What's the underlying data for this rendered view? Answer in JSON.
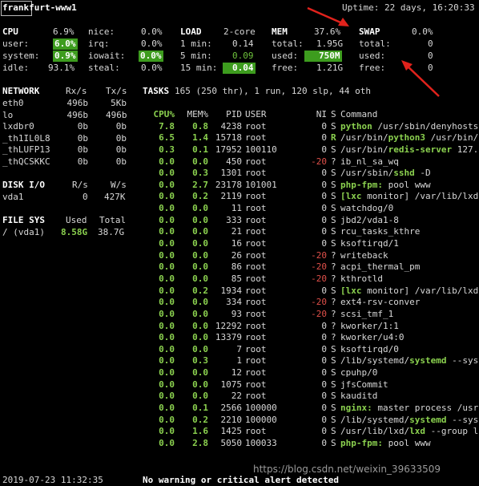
{
  "header": {
    "hostname": "frankfurt-www1",
    "uptime": "Uptime: 22 days, 16:20:33"
  },
  "cpu": {
    "label": "CPU",
    "total": "6.9%",
    "rows": [
      {
        "k1": "user:",
        "v1": "6.0%",
        "k2": "nice:",
        "v2": "0.0%"
      },
      {
        "k1": "system:",
        "v1": "0.9%",
        "k2": "irq:",
        "v2": "0.0%"
      },
      {
        "k1": "idle:",
        "v1": "93.1%",
        "k2": "iowait:",
        "v2": "0.0%"
      },
      {
        "k1": "",
        "v1": "",
        "k2": "steal:",
        "v2": "0.0%"
      }
    ]
  },
  "load": {
    "label": "LOAD",
    "cores": "2-core",
    "rows": [
      {
        "k": "1 min:",
        "v": "0.14"
      },
      {
        "k": "5 min:",
        "v": "0.09"
      },
      {
        "k": "15 min:",
        "v": "0.04"
      }
    ]
  },
  "mem": {
    "label": "MEM",
    "percent": "37.6%",
    "rows": [
      {
        "k": "total:",
        "v": "1.95G"
      },
      {
        "k": "used:",
        "v": "750M"
      },
      {
        "k": "free:",
        "v": "1.21G"
      }
    ]
  },
  "swap": {
    "label": "SWAP",
    "percent": "0.0%",
    "rows": [
      {
        "k": "total:",
        "v": "0"
      },
      {
        "k": "used:",
        "v": "0"
      },
      {
        "k": "free:",
        "v": "0"
      }
    ]
  },
  "network": {
    "label": "NETWORK",
    "rx": "Rx/s",
    "tx": "Tx/s",
    "rows": [
      {
        "name": "eth0",
        "rx": "496b",
        "tx": "5Kb"
      },
      {
        "name": "lo",
        "rx": "496b",
        "tx": "496b"
      },
      {
        "name": "lxdbr0",
        "rx": "0b",
        "tx": "0b"
      },
      {
        "name": "_th1IL0L8",
        "rx": "0b",
        "tx": "0b"
      },
      {
        "name": "_thLUFP13",
        "rx": "0b",
        "tx": "0b"
      },
      {
        "name": "_thQCSKKC",
        "rx": "0b",
        "tx": "0b"
      }
    ]
  },
  "disk": {
    "label": "DISK I/O",
    "r": "R/s",
    "w": "W/s",
    "rows": [
      {
        "name": "vda1",
        "r": "0",
        "w": "427K"
      }
    ]
  },
  "fs": {
    "label": "FILE SYS",
    "used": "Used",
    "total": "Total",
    "rows": [
      {
        "name": "/ (vda1)",
        "used": "8.58G",
        "total": "38.7G"
      }
    ]
  },
  "tasks": {
    "label": "TASKS",
    "summary": "165 (250 thr), 1 run, 120 slp, 44 oth"
  },
  "proc_headers": {
    "cpu": "CPU%",
    "mem": "MEM%",
    "pid": "PID",
    "user": "USER",
    "ni": "NI",
    "s": "S",
    "cmd": "Command"
  },
  "processes": [
    {
      "cpu": "7.8",
      "mem": "0.8",
      "pid": "4238",
      "user": "root",
      "ni": "0",
      "s": "S",
      "prog": "python",
      "args": " /usr/sbin/denyhosts",
      "pre": ""
    },
    {
      "cpu": "6.5",
      "mem": "1.4",
      "pid": "15718",
      "user": "root",
      "ni": "0",
      "s": "R",
      "pre": "/usr/bin/",
      "prog": "python3",
      "args": " /usr/bin/"
    },
    {
      "cpu": "0.3",
      "mem": "0.1",
      "pid": "17952",
      "user": "100110",
      "ni": "0",
      "s": "S",
      "pre": "/usr/bin/",
      "prog": "redis-server",
      "args": " 127."
    },
    {
      "cpu": "0.0",
      "mem": "0.0",
      "pid": "450",
      "user": "root",
      "ni": "-20",
      "s": "?",
      "pre": "ib_nl_sa_wq",
      "prog": "",
      "args": ""
    },
    {
      "cpu": "0.0",
      "mem": "0.3",
      "pid": "1301",
      "user": "root",
      "ni": "0",
      "s": "S",
      "pre": "/usr/sbin/",
      "prog": "sshd",
      "args": " -D"
    },
    {
      "cpu": "0.0",
      "mem": "2.7",
      "pid": "23178",
      "user": "101001",
      "ni": "0",
      "s": "S",
      "pre": "",
      "prog": "php-fpm:",
      "args": " pool www"
    },
    {
      "cpu": "0.0",
      "mem": "0.2",
      "pid": "2119",
      "user": "root",
      "ni": "0",
      "s": "S",
      "pre": "",
      "prog": "[lxc",
      "args": " monitor] /var/lib/lxd"
    },
    {
      "cpu": "0.0",
      "mem": "0.0",
      "pid": "11",
      "user": "root",
      "ni": "0",
      "s": "S",
      "pre": "watchdog/0",
      "prog": "",
      "args": ""
    },
    {
      "cpu": "0.0",
      "mem": "0.0",
      "pid": "333",
      "user": "root",
      "ni": "0",
      "s": "S",
      "pre": "jbd2/vda1-8",
      "prog": "",
      "args": ""
    },
    {
      "cpu": "0.0",
      "mem": "0.0",
      "pid": "21",
      "user": "root",
      "ni": "0",
      "s": "S",
      "pre": "rcu_tasks_kthre",
      "prog": "",
      "args": ""
    },
    {
      "cpu": "0.0",
      "mem": "0.0",
      "pid": "16",
      "user": "root",
      "ni": "0",
      "s": "S",
      "pre": "ksoftirqd/1",
      "prog": "",
      "args": ""
    },
    {
      "cpu": "0.0",
      "mem": "0.0",
      "pid": "26",
      "user": "root",
      "ni": "-20",
      "s": "?",
      "pre": "writeback",
      "prog": "",
      "args": ""
    },
    {
      "cpu": "0.0",
      "mem": "0.0",
      "pid": "86",
      "user": "root",
      "ni": "-20",
      "s": "?",
      "pre": "acpi_thermal_pm",
      "prog": "",
      "args": ""
    },
    {
      "cpu": "0.0",
      "mem": "0.0",
      "pid": "85",
      "user": "root",
      "ni": "-20",
      "s": "?",
      "pre": "kthrotld",
      "prog": "",
      "args": ""
    },
    {
      "cpu": "0.0",
      "mem": "0.2",
      "pid": "1934",
      "user": "root",
      "ni": "0",
      "s": "S",
      "pre": "",
      "prog": "[lxc",
      "args": " monitor] /var/lib/lxd"
    },
    {
      "cpu": "0.0",
      "mem": "0.0",
      "pid": "334",
      "user": "root",
      "ni": "-20",
      "s": "?",
      "pre": "ext4-rsv-conver",
      "prog": "",
      "args": ""
    },
    {
      "cpu": "0.0",
      "mem": "0.0",
      "pid": "93",
      "user": "root",
      "ni": "-20",
      "s": "?",
      "pre": "scsi_tmf_1",
      "prog": "",
      "args": ""
    },
    {
      "cpu": "0.0",
      "mem": "0.0",
      "pid": "12292",
      "user": "root",
      "ni": "0",
      "s": "?",
      "pre": "kworker/1:1",
      "prog": "",
      "args": ""
    },
    {
      "cpu": "0.0",
      "mem": "0.0",
      "pid": "13379",
      "user": "root",
      "ni": "0",
      "s": "?",
      "pre": "kworker/u4:0",
      "prog": "",
      "args": ""
    },
    {
      "cpu": "0.0",
      "mem": "0.0",
      "pid": "7",
      "user": "root",
      "ni": "0",
      "s": "S",
      "pre": "ksoftirqd/0",
      "prog": "",
      "args": ""
    },
    {
      "cpu": "0.0",
      "mem": "0.3",
      "pid": "1",
      "user": "root",
      "ni": "0",
      "s": "S",
      "pre": "/lib/systemd/",
      "prog": "systemd",
      "args": " --sys"
    },
    {
      "cpu": "0.0",
      "mem": "0.0",
      "pid": "12",
      "user": "root",
      "ni": "0",
      "s": "S",
      "pre": "cpuhp/0",
      "prog": "",
      "args": ""
    },
    {
      "cpu": "0.0",
      "mem": "0.0",
      "pid": "1075",
      "user": "root",
      "ni": "0",
      "s": "S",
      "pre": "jfsCommit",
      "prog": "",
      "args": ""
    },
    {
      "cpu": "0.0",
      "mem": "0.0",
      "pid": "22",
      "user": "root",
      "ni": "0",
      "s": "S",
      "pre": "kauditd",
      "prog": "",
      "args": ""
    },
    {
      "cpu": "0.0",
      "mem": "0.1",
      "pid": "2566",
      "user": "100000",
      "ni": "0",
      "s": "S",
      "pre": "",
      "prog": "nginx:",
      "args": " master process /usr"
    },
    {
      "cpu": "0.0",
      "mem": "0.2",
      "pid": "2210",
      "user": "100000",
      "ni": "0",
      "s": "S",
      "pre": "/lib/systemd/",
      "prog": "systemd",
      "args": " --sys"
    },
    {
      "cpu": "0.0",
      "mem": "1.6",
      "pid": "1425",
      "user": "root",
      "ni": "0",
      "s": "S",
      "pre": "/usr/lib/lxd/",
      "prog": "lxd",
      "args": " --group l"
    },
    {
      "cpu": "0.0",
      "mem": "2.8",
      "pid": "5050",
      "user": "100033",
      "ni": "0",
      "s": "S",
      "pre": "",
      "prog": "php-fpm:",
      "args": " pool www"
    }
  ],
  "footer": {
    "timestamp": "2019-07-23 11:32:35",
    "alert": "No warning or critical alert detected",
    "watermark": "https://blog.csdn.net/weixin_39633509"
  },
  "colors": {
    "green": "#6ec23c",
    "highlight": "#3d9c1e",
    "red_nice": "#e0504a",
    "arrow": "#e0221c"
  }
}
